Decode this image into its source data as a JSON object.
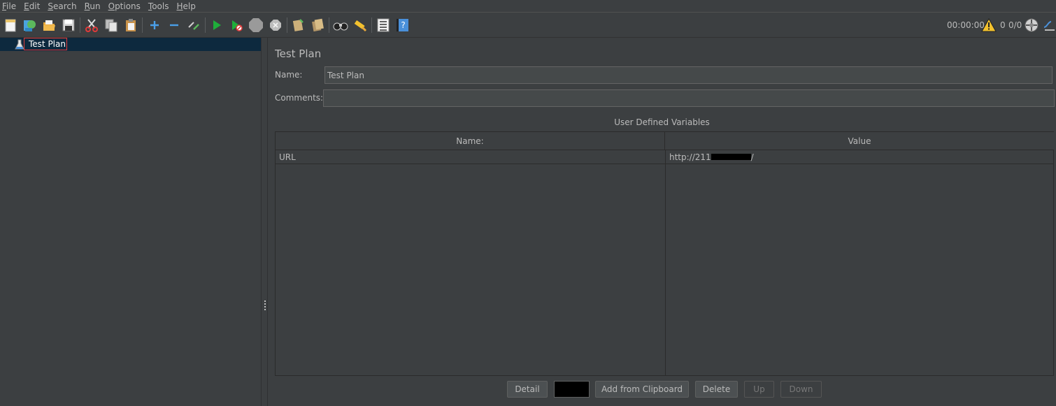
{
  "menu": {
    "items": [
      {
        "mnemonic": "F",
        "rest": "ile"
      },
      {
        "mnemonic": "E",
        "rest": "dit"
      },
      {
        "mnemonic": "S",
        "rest": "earch"
      },
      {
        "mnemonic": "R",
        "rest": "un"
      },
      {
        "mnemonic": "O",
        "rest": "ptions"
      },
      {
        "mnemonic": "T",
        "rest": "ools"
      },
      {
        "mnemonic": "H",
        "rest": "elp"
      }
    ]
  },
  "toolbar": {
    "elapsed_time": "00:00:00",
    "warning_count": "0",
    "threads": "0/0"
  },
  "tree": {
    "root_label": "Test Plan"
  },
  "test_plan": {
    "title": "Test Plan",
    "name_label": "Name:",
    "name_value": "Test Plan",
    "comments_label": "Comments:",
    "comments_value": "",
    "udv_title": "User Defined Variables",
    "columns": {
      "name": "Name:",
      "value": "Value"
    },
    "rows": [
      {
        "name": "URL",
        "value_prefix": "http://211",
        "value_suffix": "/"
      }
    ],
    "buttons": {
      "detail": "Detail",
      "add_from_clipboard": "Add from Clipboard",
      "delete": "Delete",
      "up": "Up",
      "down": "Down"
    }
  },
  "colors": {
    "background": "#3c3f41",
    "selection": "#0d293e",
    "highlight_border": "#e03a3a",
    "text": "#bbbbbb"
  }
}
